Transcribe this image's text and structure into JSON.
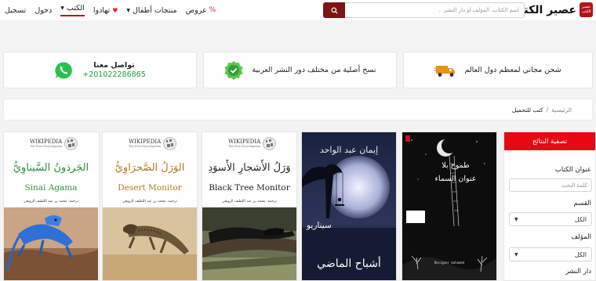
{
  "header": {
    "logo_badge": "عصير الكتب",
    "site_name": "عصير الكتب",
    "search_placeholder": "اسم الكتاب، المؤلف أو دار النشر...",
    "nav": {
      "offers": "عروض",
      "kids_products": "منتجات أطفال",
      "exchange": "تهادوا",
      "books": "الكتب",
      "login": "دخول",
      "register": "تسجيل"
    },
    "accent": "#c0141c"
  },
  "features": {
    "shipping": "شحن مجاني لمعظم دول العالم",
    "original": "نسخ أصلية من مختلف دور النشر العربية",
    "contact_title": "تواصل معنا",
    "contact_phone": "+201022286865"
  },
  "breadcrumb": {
    "home": "الرئيسية",
    "separator": "/",
    "current": "كتب للتحميل"
  },
  "filter": {
    "heading": "تصفية النتائج",
    "title_label": "عنوان الكتاب",
    "title_placeholder": "كلمة البحث",
    "category_label": "القسم",
    "category_value": "الكل",
    "author_label": "المؤلف",
    "author_value": "الكل",
    "publisher_label": "دار النشر"
  },
  "books": [
    {
      "title": "طموح بلا عنوان السماء",
      "icon": "moon-ladder-cover",
      "bg": "#0e0e0e"
    },
    {
      "author": "إيمان عبد الواحد",
      "title_top": "سيناريو",
      "title": "أشباح الماضي",
      "icon": "moon-swing-cover"
    },
    {
      "ar_title": "وَرَلُ الأَشجارِ الأَسوَدِ",
      "en_title": "Black Tree Monitor",
      "translator": "ترجمة: محمد بن عبد اللطيف الرويعي",
      "title_color": "#222222"
    },
    {
      "ar_title": "الوَرَلُ الصَّحرَاوِيُّ",
      "en_title": "Desert Monitor",
      "translator": "ترجمة: محمد بن عبد اللطيف الرويعي",
      "title_color": "#b5791f"
    },
    {
      "ar_title": "الجَرذونُ السَّيناوِيُّ",
      "en_title": "Sinai Agama",
      "translator": "ترجمة: محمد بن عبد اللطيف الرويعي",
      "title_color": "#2e8f3a"
    }
  ],
  "wiki": {
    "name": "WIKIPEDIA",
    "tagline": "The Free Encyclopedia"
  }
}
